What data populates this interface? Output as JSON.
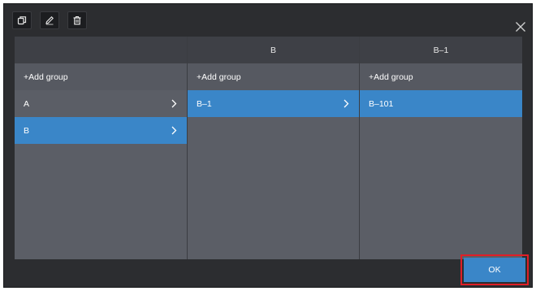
{
  "toolbar": {
    "icons": [
      "copy-icon",
      "edit-icon",
      "delete-icon"
    ]
  },
  "close_icon": "close-icon",
  "columns": [
    {
      "header": "",
      "add_label": "+Add group",
      "items": [
        {
          "label": "A",
          "selected": false,
          "has_children": true
        },
        {
          "label": "B",
          "selected": true,
          "has_children": true
        }
      ]
    },
    {
      "header": "B",
      "add_label": "+Add group",
      "items": [
        {
          "label": "B–1",
          "selected": true,
          "has_children": true
        }
      ]
    },
    {
      "header": "B–1",
      "add_label": "+Add group",
      "items": [
        {
          "label": "B–101",
          "selected": true,
          "has_children": false
        }
      ]
    }
  ],
  "ok_label": "OK",
  "colors": {
    "background": "#2c2d30",
    "column": "#5b5e66",
    "header": "#3e4046",
    "selected": "#3a86c8",
    "highlight": "#e01f27"
  }
}
